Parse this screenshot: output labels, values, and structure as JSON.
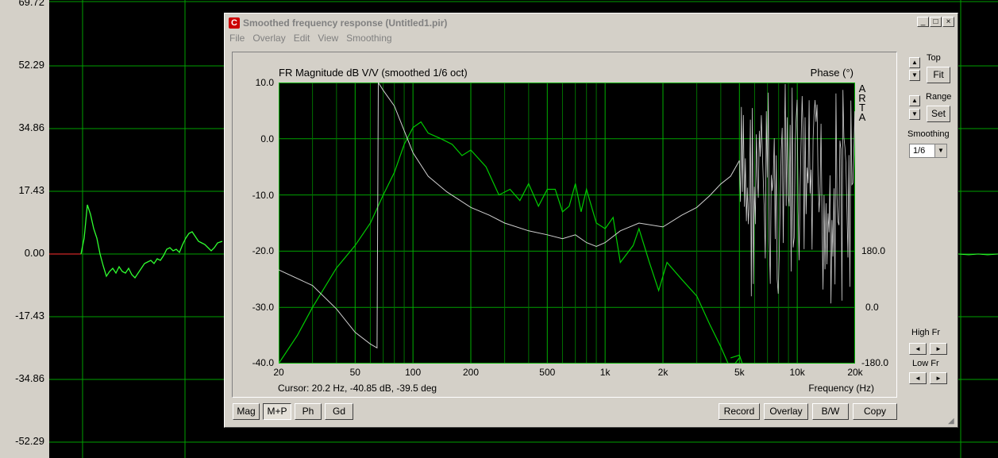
{
  "background_plot": {
    "y_labels": [
      "69.72",
      "52.29",
      "34.86",
      "17.43",
      "0.00",
      "-17.43",
      "-34.86",
      "-52.29"
    ]
  },
  "window": {
    "title": "Smoothed frequency response (Untitled1.pir)",
    "menu": [
      "File",
      "Overlay",
      "Edit",
      "View",
      "Smoothing"
    ],
    "controls": {
      "minimize": "_",
      "maximize": "□",
      "close": "×"
    }
  },
  "chart_data": {
    "type": "line",
    "title": "FR Magnitude dB V/V (smoothed 1/6 oct)",
    "y2label": "Phase (°)",
    "xlabel": "Frequency (Hz)",
    "watermark": "ARTA",
    "x_scale": "log",
    "xlim": [
      20,
      20000
    ],
    "ylim": [
      -40,
      10
    ],
    "y2lim": [
      -180,
      180
    ],
    "x_ticks": [
      "20",
      "50",
      "100",
      "200",
      "500",
      "1k",
      "2k",
      "5k",
      "10k",
      "20k"
    ],
    "y_ticks": [
      "10.0",
      "0.0",
      "-10.0",
      "-20.0",
      "-30.0",
      "-40.0"
    ],
    "y2_ticks": [
      "180.0",
      "0.0",
      "-180.0"
    ],
    "grid": true,
    "series": [
      {
        "color": "#00cc00",
        "x": [
          20,
          25,
          30,
          40,
          50,
          60,
          70,
          80,
          90,
          100,
          110,
          120,
          140,
          160,
          180,
          200,
          240,
          280,
          320,
          360,
          400,
          450,
          500,
          550,
          600,
          650,
          700,
          750,
          800,
          900,
          1000,
          1100,
          1200,
          1400,
          1500,
          1700,
          1900,
          2100,
          2500,
          3000,
          3500,
          4000,
          4500,
          5000
        ],
        "y": [
          -40,
          -35,
          -30,
          -23,
          -19,
          -15,
          -10,
          -6,
          -1,
          2,
          3,
          1,
          0,
          -1,
          -3,
          -2,
          -5,
          -10,
          -9,
          -11,
          -8,
          -12,
          -9,
          -9,
          -13,
          -12,
          -8,
          -13,
          -9,
          -15,
          -16,
          -14,
          -22,
          -19,
          -16,
          -22,
          -27,
          -22,
          -25,
          -28,
          -33,
          -37,
          -41,
          -39
        ]
      },
      {
        "color": "#d0d0d0",
        "x": [
          20,
          30,
          40,
          50,
          60,
          65,
          66,
          70,
          80,
          100,
          120,
          150,
          200,
          250,
          300,
          400,
          500,
          600,
          700,
          800,
          900,
          1000,
          1200,
          1500,
          2000,
          2500,
          3000,
          3500,
          4000,
          4500,
          5000
        ],
        "y": [
          -60,
          -80,
          -110,
          -140,
          -155,
          -160,
          180,
          170,
          150,
          90,
          60,
          40,
          20,
          10,
          0,
          -10,
          -15,
          -20,
          -15,
          -25,
          -30,
          -25,
          -10,
          0,
          -5,
          10,
          20,
          35,
          50,
          60,
          80
        ]
      }
    ]
  },
  "cursor_readout": "Cursor: 20.2 Hz, -40.85 dB, -39.5 deg",
  "bottom_buttons": {
    "mag": "Mag",
    "mp": "M+P",
    "ph": "Ph",
    "gd": "Gd",
    "record": "Record",
    "overlay": "Overlay",
    "bw": "B/W",
    "copy": "Copy"
  },
  "side_panel": {
    "top_label": "Top",
    "fit": "Fit",
    "range_label": "Range",
    "set": "Set",
    "smoothing_label": "Smoothing",
    "smoothing_value": "1/6",
    "high_fr_label": "High Fr",
    "low_fr_label": "Low Fr"
  }
}
